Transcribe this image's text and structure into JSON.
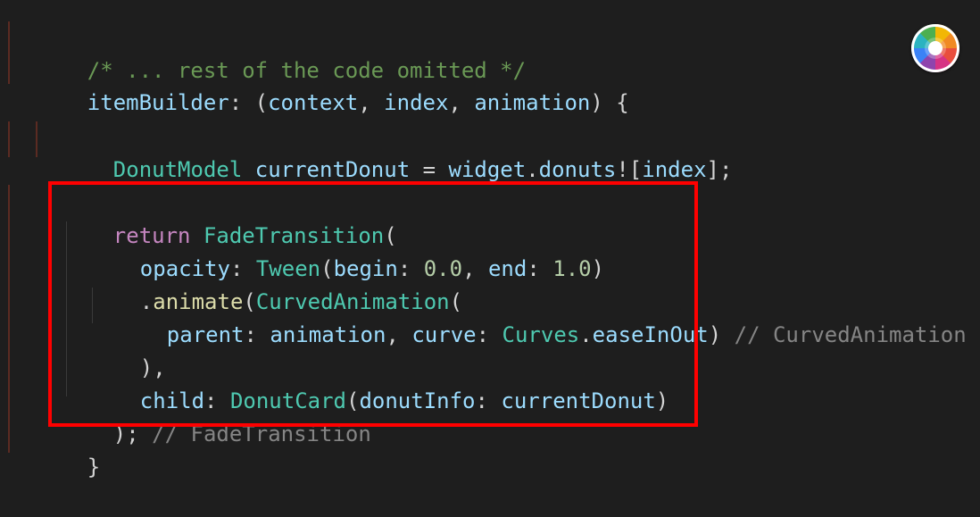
{
  "editor": {
    "lines": [
      {
        "tokens": [
          {
            "text": "/* ... rest of the code omitted */",
            "kind": "comment-green"
          }
        ]
      },
      {
        "tokens": [
          {
            "text": "itemBuilder",
            "kind": "var"
          },
          {
            "text": ": (",
            "kind": "punct"
          },
          {
            "text": "context",
            "kind": "var"
          },
          {
            "text": ", ",
            "kind": "punct"
          },
          {
            "text": "index",
            "kind": "var"
          },
          {
            "text": ", ",
            "kind": "punct"
          },
          {
            "text": "animation",
            "kind": "var"
          },
          {
            "text": ") {",
            "kind": "punct"
          }
        ]
      },
      {
        "tokens": [
          {
            "text": "DonutModel",
            "kind": "type"
          },
          {
            "text": " ",
            "kind": "punct"
          },
          {
            "text": "currentDonut",
            "kind": "var"
          },
          {
            "text": " = ",
            "kind": "punct"
          },
          {
            "text": "widget",
            "kind": "var"
          },
          {
            "text": ".",
            "kind": "punct"
          },
          {
            "text": "donuts",
            "kind": "var"
          },
          {
            "text": "![",
            "kind": "punct"
          },
          {
            "text": "index",
            "kind": "var"
          },
          {
            "text": "];",
            "kind": "punct"
          }
        ]
      },
      {
        "tokens": [
          {
            "text": "return",
            "kind": "kw"
          },
          {
            "text": " ",
            "kind": "punct"
          },
          {
            "text": "FadeTransition",
            "kind": "type"
          },
          {
            "text": "(",
            "kind": "punct"
          }
        ]
      },
      {
        "tokens": [
          {
            "text": "opacity",
            "kind": "var"
          },
          {
            "text": ": ",
            "kind": "punct"
          },
          {
            "text": "Tween",
            "kind": "type"
          },
          {
            "text": "(",
            "kind": "punct"
          },
          {
            "text": "begin",
            "kind": "var"
          },
          {
            "text": ": ",
            "kind": "punct"
          },
          {
            "text": "0.0",
            "kind": "num"
          },
          {
            "text": ", ",
            "kind": "punct"
          },
          {
            "text": "end",
            "kind": "var"
          },
          {
            "text": ": ",
            "kind": "punct"
          },
          {
            "text": "1.0",
            "kind": "num"
          },
          {
            "text": ")",
            "kind": "punct"
          }
        ]
      },
      {
        "tokens": [
          {
            "text": ".",
            "kind": "punct"
          },
          {
            "text": "animate",
            "kind": "fn"
          },
          {
            "text": "(",
            "kind": "punct"
          },
          {
            "text": "CurvedAnimation",
            "kind": "type"
          },
          {
            "text": "(",
            "kind": "punct"
          }
        ]
      },
      {
        "tokens": [
          {
            "text": "parent",
            "kind": "var"
          },
          {
            "text": ": ",
            "kind": "punct"
          },
          {
            "text": "animation",
            "kind": "var"
          },
          {
            "text": ", ",
            "kind": "punct"
          },
          {
            "text": "curve",
            "kind": "var"
          },
          {
            "text": ": ",
            "kind": "punct"
          },
          {
            "text": "Curves",
            "kind": "type"
          },
          {
            "text": ".",
            "kind": "punct"
          },
          {
            "text": "easeInOut",
            "kind": "var"
          },
          {
            "text": ")",
            "kind": "punct"
          },
          {
            "text": " // CurvedAnimation",
            "kind": "comment-gray"
          }
        ]
      },
      {
        "tokens": [
          {
            "text": "),",
            "kind": "punct"
          }
        ]
      },
      {
        "tokens": [
          {
            "text": "child",
            "kind": "var"
          },
          {
            "text": ": ",
            "kind": "punct"
          },
          {
            "text": "DonutCard",
            "kind": "type"
          },
          {
            "text": "(",
            "kind": "punct"
          },
          {
            "text": "donutInfo",
            "kind": "var"
          },
          {
            "text": ": ",
            "kind": "punct"
          },
          {
            "text": "currentDonut",
            "kind": "var"
          },
          {
            "text": ")",
            "kind": "punct"
          }
        ]
      },
      {
        "tokens": [
          {
            "text": ");",
            "kind": "punct"
          },
          {
            "text": " // FadeTransition",
            "kind": "comment-gray"
          }
        ]
      },
      {
        "tokens": [
          {
            "text": "}",
            "kind": "punct"
          }
        ]
      }
    ]
  },
  "overlay": {
    "icon": "color-wheel-icon"
  }
}
